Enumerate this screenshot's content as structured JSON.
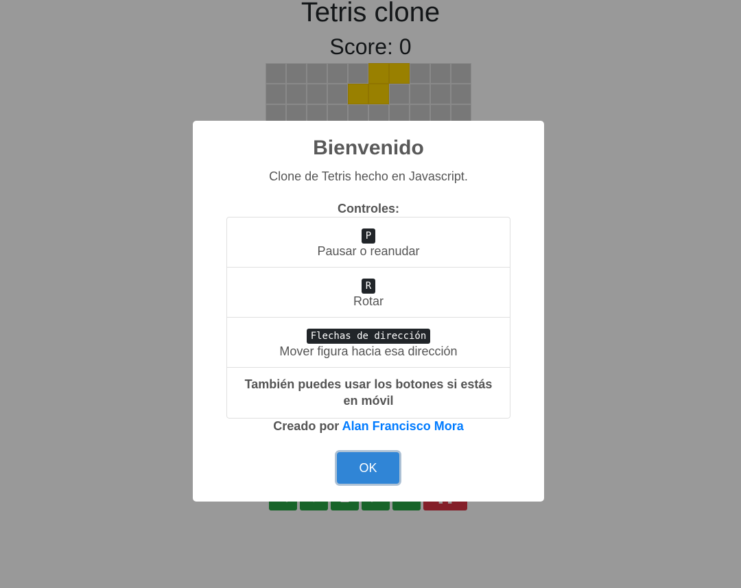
{
  "game": {
    "title": "Tetris clone",
    "score_label": "Score: 0",
    "board": {
      "cols": 10,
      "rows": 20,
      "filled_cells": [
        [
          0,
          5
        ],
        [
          0,
          6
        ],
        [
          1,
          4
        ],
        [
          1,
          5
        ]
      ],
      "piece_color": "#ffd500"
    },
    "controls": [
      {
        "name": "left-button",
        "icon": "arrow-left-icon",
        "glyph": "◀",
        "color": "#28a745"
      },
      {
        "name": "down-button",
        "icon": "arrow-down-icon",
        "glyph": "▼",
        "color": "#28a745"
      },
      {
        "name": "up-button",
        "icon": "arrow-up-icon",
        "glyph": "▲",
        "color": "#28a745"
      },
      {
        "name": "right-button",
        "icon": "arrow-right-icon",
        "glyph": "▶",
        "color": "#28a745"
      },
      {
        "name": "rotate-button",
        "icon": "rotate-icon",
        "glyph": "↻",
        "color": "#28a745"
      },
      {
        "name": "pause-button",
        "icon": "pause-icon",
        "glyph": "❚❚",
        "color": "#dc3545"
      }
    ]
  },
  "modal": {
    "title": "Bienvenido",
    "description": "Clone de Tetris hecho en Javascript.",
    "controls_heading": "Controles:",
    "items": [
      {
        "key": "P",
        "label": "Pausar o reanudar"
      },
      {
        "key": "R",
        "label": "Rotar"
      },
      {
        "key": "Flechas de dirección",
        "label": "Mover figura hacia esa dirección"
      }
    ],
    "note": "También puedes usar los botones si estás en móvil",
    "credit_prefix": "Creado por",
    "credit_author": "Alan Francisco Mora",
    "ok_label": "OK"
  },
  "colors": {
    "accent": "#3085d6",
    "link": "#007bff",
    "kbd_bg": "#212529"
  }
}
